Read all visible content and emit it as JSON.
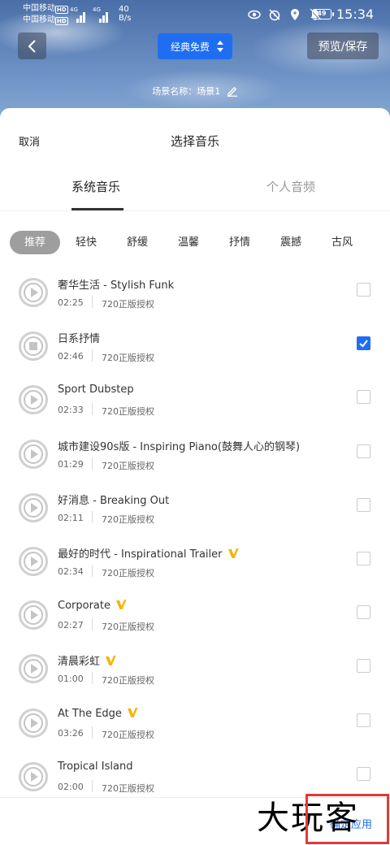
{
  "status_bar": {
    "carrier1": "中国移动",
    "carrier2": "中国移动",
    "hd": "HD",
    "net1": "4G",
    "net2": "4G",
    "speed_value": "40",
    "speed_unit": "B/s",
    "battery": "49",
    "time": "15:34"
  },
  "toolbar": {
    "mode_label": "经典免费",
    "preview_label": "预览/保存",
    "scene_label": "场景名称：场景1"
  },
  "sheet": {
    "cancel": "取消",
    "title": "选择音乐",
    "tabs": [
      "系统音乐",
      "个人音频"
    ],
    "chips": [
      "推荐",
      "轻快",
      "舒缓",
      "温馨",
      "抒情",
      "震撼",
      "古风"
    ]
  },
  "songs": [
    {
      "title": "奢华生活 - Stylish Funk",
      "duration": "02:25",
      "license": "720正版授权",
      "vip": false,
      "checked": false,
      "playing": false
    },
    {
      "title": "日系抒情",
      "duration": "02:46",
      "license": "720正版授权",
      "vip": false,
      "checked": true,
      "playing": true
    },
    {
      "title": "Sport Dubstep",
      "duration": "02:33",
      "license": "720正版授权",
      "vip": false,
      "checked": false,
      "playing": false
    },
    {
      "title": "城市建设90s版 - Inspiring Piano(鼓舞人心的钢琴)",
      "duration": "01:29",
      "license": "720正版授权",
      "vip": false,
      "checked": false,
      "playing": false
    },
    {
      "title": "好消息 - Breaking Out",
      "duration": "02:11",
      "license": "720正版授权",
      "vip": false,
      "checked": false,
      "playing": false
    },
    {
      "title": "最好的时代 - Inspirational Trailer",
      "duration": "02:34",
      "license": "720正版授权",
      "vip": true,
      "checked": false,
      "playing": false
    },
    {
      "title": "Corporate",
      "duration": "02:27",
      "license": "720正版授权",
      "vip": true,
      "checked": false,
      "playing": false
    },
    {
      "title": "清晨彩虹",
      "duration": "01:00",
      "license": "720正版授权",
      "vip": true,
      "checked": false,
      "playing": false
    },
    {
      "title": "At The Edge",
      "duration": "03:26",
      "license": "720正版授权",
      "vip": true,
      "checked": false,
      "playing": false
    },
    {
      "title": "Tropical Island",
      "duration": "02:00",
      "license": "720正版授权",
      "vip": false,
      "checked": false,
      "playing": false
    }
  ],
  "footer": {
    "confirm": "确定应用",
    "watermark": "大玩客"
  },
  "colors": {
    "accent": "#1f6ef2",
    "vip": "#f5b400",
    "highlight_box": "#e53935"
  }
}
